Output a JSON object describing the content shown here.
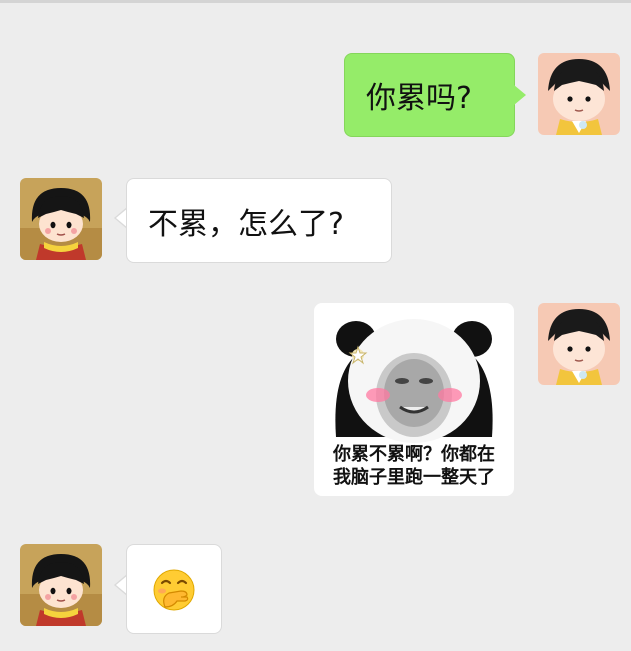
{
  "messages": {
    "m1": {
      "sender": "me",
      "text": "你累吗?"
    },
    "m2": {
      "sender": "other",
      "text": "不累，怎么了?"
    },
    "m3": {
      "sender": "me",
      "sticker_caption_line1": "你累不累啊？你都在",
      "sticker_caption_line2": "我脑子里跑一整天了"
    },
    "m4": {
      "sender": "other",
      "emoji": "🤭"
    }
  },
  "colors": {
    "background": "#ededed",
    "my_bubble": "#95ec69",
    "other_bubble": "#ffffff"
  }
}
